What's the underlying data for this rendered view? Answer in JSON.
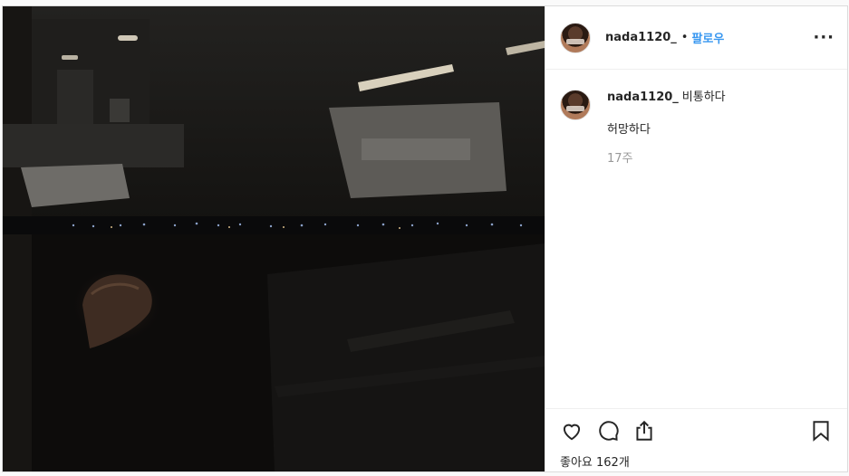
{
  "post": {
    "author": {
      "username": "nada1120_",
      "separator": "•",
      "follow_label": "팔로우",
      "more_label": "···"
    },
    "caption": {
      "username": "nada1120_",
      "text": "비통하다",
      "second_line": "허망하다",
      "time_ago": "17주"
    },
    "likes": {
      "label": "좋아요 162개"
    },
    "icons": {
      "like": "heart-icon",
      "comment": "comment-icon",
      "share": "share-icon",
      "save": "bookmark-icon"
    },
    "colors": {
      "link_blue": "#3897f0",
      "text": "#262626",
      "muted": "#999999",
      "border": "#efefef"
    }
  }
}
